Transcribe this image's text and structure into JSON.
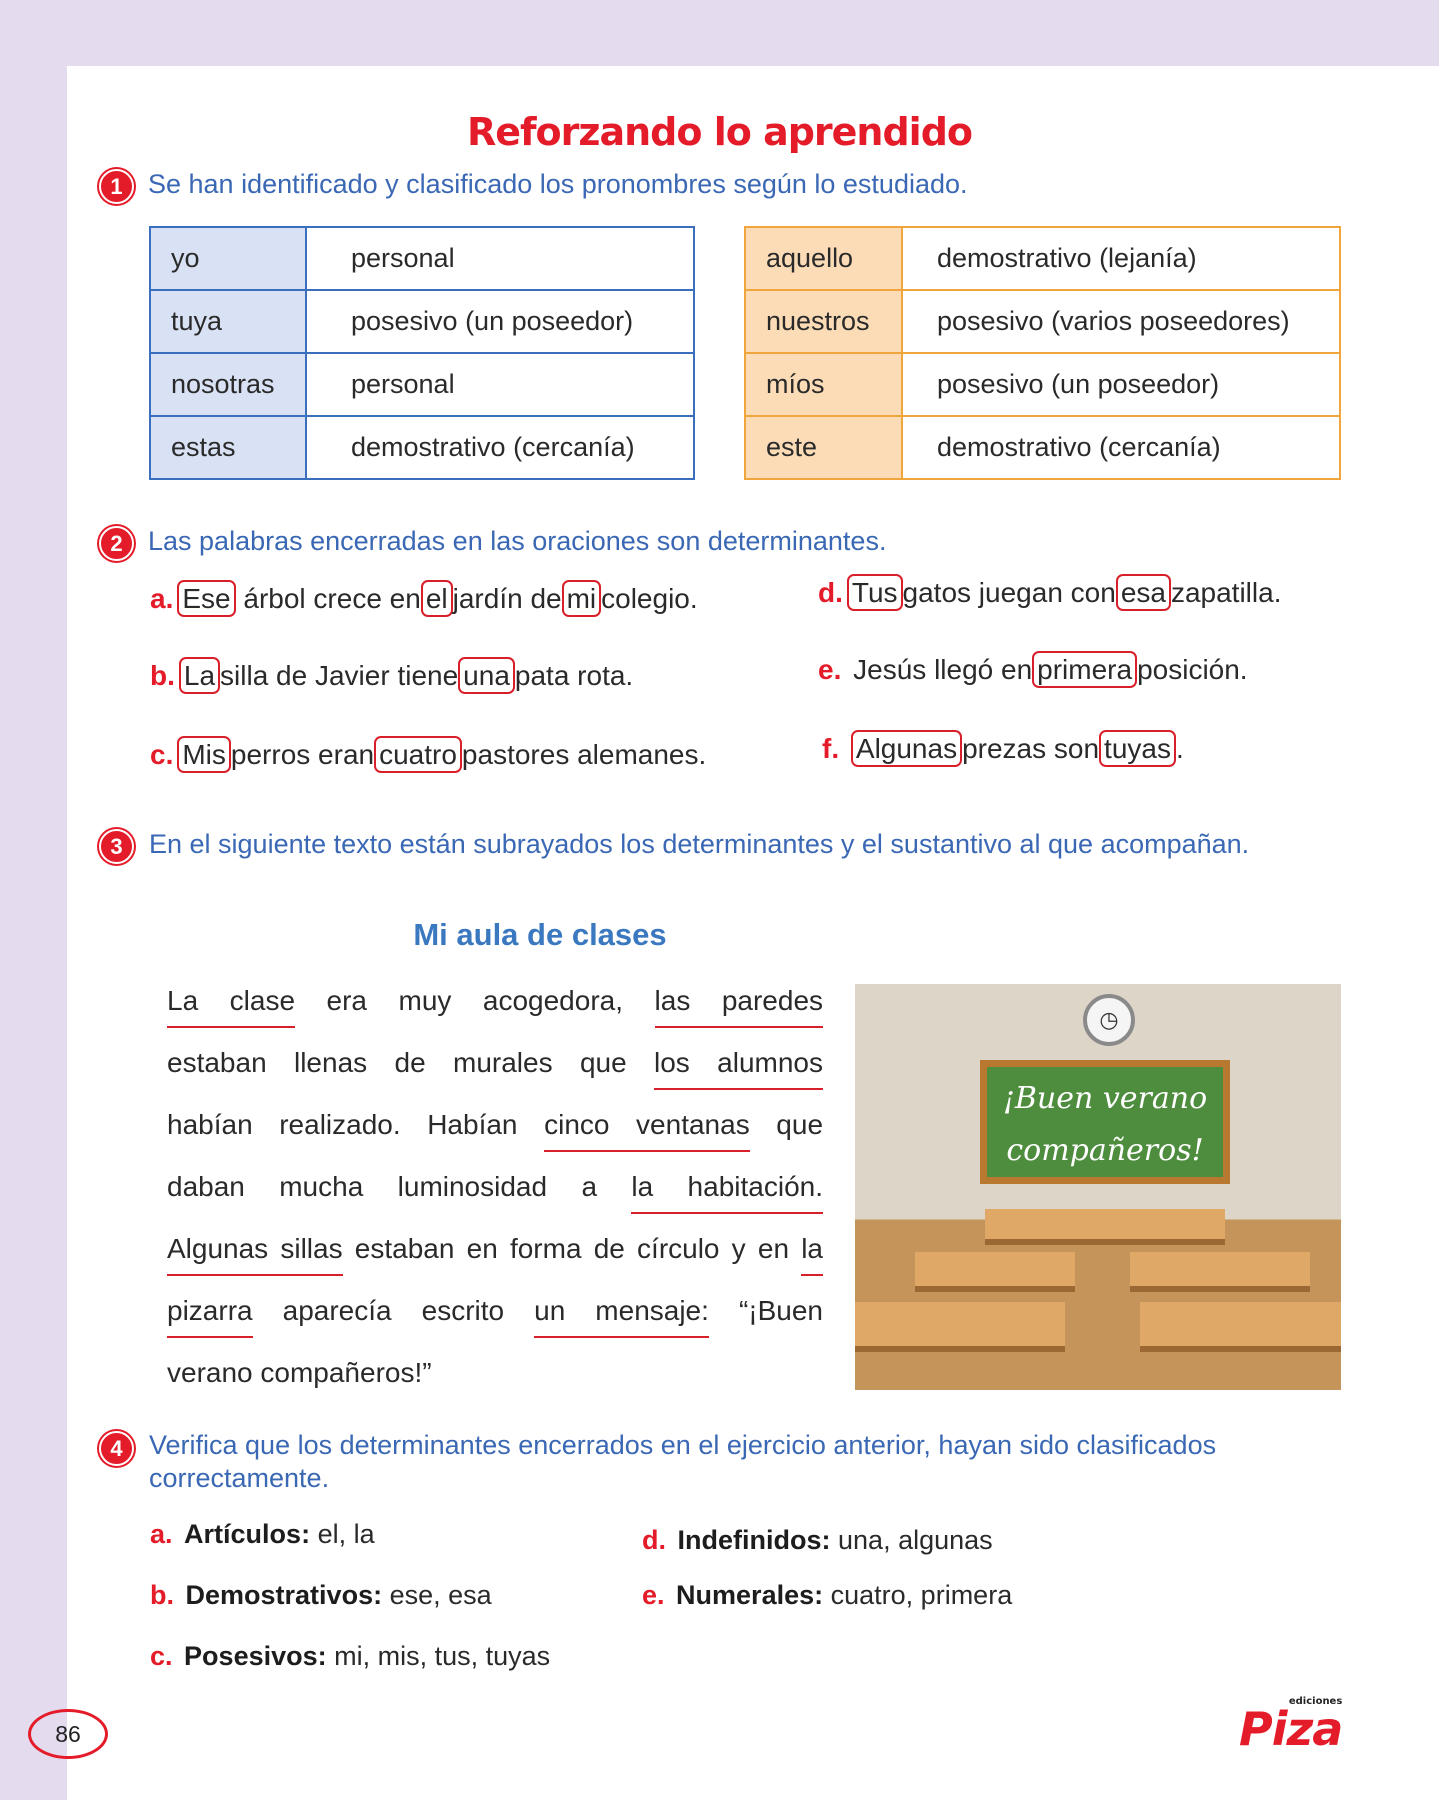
{
  "title": "Reforzando lo aprendido",
  "exercise1": {
    "number": "1",
    "instruction": "Se han identificado y clasificado los pronombres según lo estudiado.",
    "table_left": [
      {
        "word": "yo",
        "type": "personal"
      },
      {
        "word": "tuya",
        "type": "posesivo (un poseedor)"
      },
      {
        "word": "nosotras",
        "type": "personal"
      },
      {
        "word": "estas",
        "type": "demostrativo (cercanía)"
      }
    ],
    "table_right": [
      {
        "word": "aquello",
        "type": "demostrativo (lejanía)"
      },
      {
        "word": "nuestros",
        "type": "posesivo (varios poseedores)"
      },
      {
        "word": "míos",
        "type": "posesivo (un poseedor)"
      },
      {
        "word": "este",
        "type": "demostrativo (cercanía)"
      }
    ]
  },
  "exercise2": {
    "number": "2",
    "instruction": "Las palabras encerradas en las oraciones son determinantes.",
    "a": {
      "label": "a.",
      "w1": "Ese",
      "t1": "árbol crece en",
      "w2": "el",
      "t2": "jardín de",
      "w3": "mi",
      "t3": "colegio."
    },
    "b": {
      "label": "b.",
      "w1": "La",
      "t1": "silla de Javier tiene",
      "w2": "una",
      "t2": "pata rota."
    },
    "c": {
      "label": "c.",
      "w1": "Mis",
      "t1": "perros eran",
      "w2": "cuatro",
      "t2": "pastores alemanes."
    },
    "d": {
      "label": "d.",
      "w1": "Tus",
      "t1": "gatos juegan con",
      "w2": "esa",
      "t2": "zapatilla."
    },
    "e": {
      "label": "e.",
      "t0": "Jesús llegó en",
      "w1": "primera",
      "t1": "posición."
    },
    "f": {
      "label": "f.",
      "w1": "Algunas",
      "t1": "prezas son",
      "w2": "tuyas",
      "t2": "."
    }
  },
  "exercise3": {
    "number": "3",
    "instruction": "En el siguiente texto están subrayados los determinantes y el sustantivo al que acompañan.",
    "subtitle": "Mi aula de clases",
    "l1": {
      "u1": "La clase",
      "t1": "era muy acogedora,",
      "u2": "las paredes"
    },
    "l2": {
      "t1": "estaban llenas de murales que",
      "u1": "los alumnos"
    },
    "l3": {
      "t1": "habían realizado. Habían",
      "u1": "cinco ventanas",
      "t2": "que"
    },
    "l4": {
      "t1": "daban mucha luminosidad a",
      "u1": "la habitación."
    },
    "l5": {
      "u1": "Algunas sillas",
      "t1": "estaban en forma de círculo y en",
      "u2": "la"
    },
    "l6": {
      "u1": "pizarra",
      "t1": "aparecía escrito",
      "u2": "un mensaje:",
      "t2": "“¡Buen"
    },
    "l7": {
      "t1": "verano compañeros!”"
    },
    "image": {
      "board_line1": "¡Buen verano",
      "board_line2": "compañeros!"
    }
  },
  "exercise4": {
    "number": "4",
    "instruction": "Verifica que los determinantes encerrados en el ejercicio anterior, hayan sido clasificados correctamente.",
    "a": {
      "label": "a.",
      "cat": "Artículos:",
      "vals": "el, la"
    },
    "b": {
      "label": "b.",
      "cat": "Demostrativos:",
      "vals": "ese, esa"
    },
    "c": {
      "label": "c.",
      "cat": "Posesivos:",
      "vals": "mi, mis, tus, tuyas"
    },
    "d": {
      "label": "d.",
      "cat": "Indefinidos:",
      "vals": "una, algunas"
    },
    "e": {
      "label": "e.",
      "cat": "Numerales:",
      "vals": "cuatro, primera"
    }
  },
  "page_number": "86",
  "logo": {
    "text": "Piza",
    "small": "ediciones"
  },
  "colors": {
    "red": "#e41b28",
    "blue": "#3a68b4",
    "table_blue": "#d9e2f4",
    "table_orange": "#fcdcb6"
  }
}
